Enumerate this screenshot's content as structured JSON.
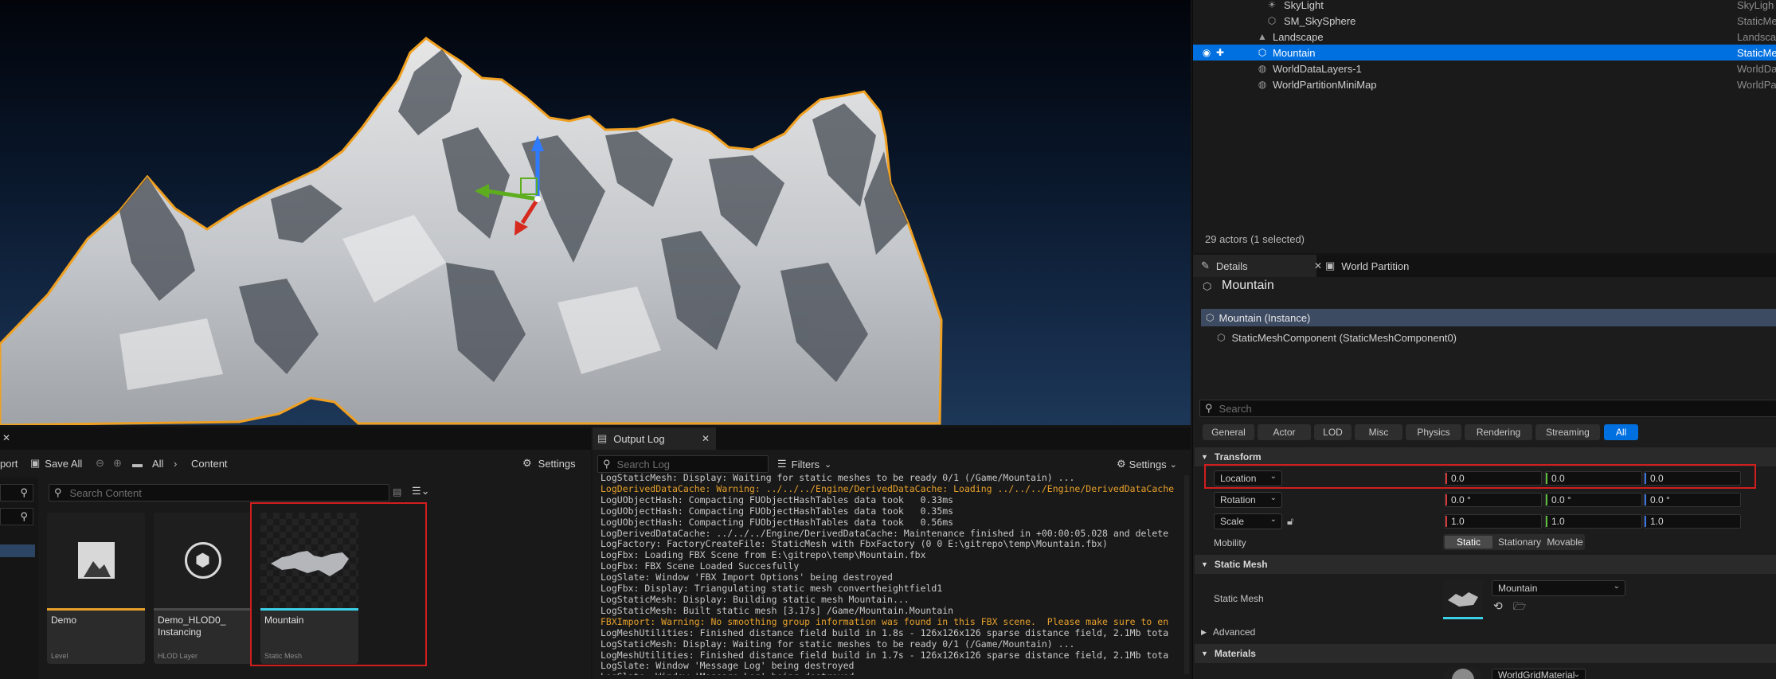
{
  "outliner": {
    "rows": [
      {
        "name": "SkyLight",
        "type": "SkyLigh"
      },
      {
        "name": "SM_SkySphere",
        "type": "StaticMe"
      },
      {
        "name": "Landscape",
        "type": "Landscap"
      },
      {
        "name": "Mountain",
        "type": "StaticMe"
      },
      {
        "name": "WorldDataLayers-1",
        "type": "WorldDat"
      },
      {
        "name": "WorldPartitionMiniMap",
        "type": "WorldPar"
      }
    ],
    "actor_count": "29 actors (1 selected)"
  },
  "details": {
    "tabs": [
      {
        "label": "Details"
      },
      {
        "label": "World Partition"
      }
    ],
    "title": "Mountain",
    "instance": "Mountain (Instance)",
    "component": "StaticMeshComponent (StaticMeshComponent0)",
    "search_placeholder": "Search",
    "filters": [
      "General",
      "Actor",
      "LOD",
      "Misc",
      "Physics",
      "Rendering",
      "Streaming",
      "All"
    ],
    "transform": {
      "section": "Transform",
      "location": {
        "label": "Location",
        "x": "0.0",
        "y": "0.0",
        "z": "0.0"
      },
      "rotation": {
        "label": "Rotation",
        "x": "0.0 °",
        "y": "0.0 °",
        "z": "0.0 °"
      },
      "scale": {
        "label": "Scale",
        "x": "1.0",
        "y": "1.0",
        "z": "1.0"
      },
      "mobility": {
        "label": "Mobility",
        "options": [
          "Static",
          "Stationary",
          "Movable"
        ],
        "selected": "Static"
      }
    },
    "static_mesh": {
      "section": "Static Mesh",
      "label": "Static Mesh",
      "value": "Mountain"
    },
    "advanced": "Advanced",
    "materials": {
      "section": "Materials",
      "value": "WorldGridMaterial"
    }
  },
  "content_browser": {
    "toolbar": {
      "import": "port",
      "save_all": "Save All",
      "path_all": "All",
      "path_content": "Content",
      "settings": "Settings"
    },
    "search_placeholder": "Search Content",
    "assets": [
      {
        "name": "Demo",
        "type": "Level"
      },
      {
        "name": "Demo_HLOD0_ Instancing",
        "type": "HLOD Layer"
      },
      {
        "name": "Mountain",
        "type": "Static Mesh"
      }
    ]
  },
  "output_log": {
    "tab": "Output Log",
    "search_placeholder": "Search Log",
    "filters": "Filters",
    "settings": "Settings",
    "lines": [
      {
        "t": "LogStaticMesh: Display: Waiting for static meshes to be ready 0/1 (/Game/Mountain) ...",
        "w": false
      },
      {
        "t": "LogDerivedDataCache: Warning: ../../../Engine/DerivedDataCache: Loading ../../../Engine/DerivedDataCache",
        "w": true
      },
      {
        "t": "LogUObjectHash: Compacting FUObjectHashTables data took   0.33ms",
        "w": false
      },
      {
        "t": "LogUObjectHash: Compacting FUObjectHashTables data took   0.35ms",
        "w": false
      },
      {
        "t": "LogUObjectHash: Compacting FUObjectHashTables data took   0.56ms",
        "w": false
      },
      {
        "t": "LogDerivedDataCache: ../../../Engine/DerivedDataCache: Maintenance finished in +00:00:05.028 and delete",
        "w": false
      },
      {
        "t": "LogFactory: FactoryCreateFile: StaticMesh with FbxFactory (0 0 E:\\gitrepo\\temp\\Mountain.fbx)",
        "w": false
      },
      {
        "t": "LogFbx: Loading FBX Scene from E:\\gitrepo\\temp\\Mountain.fbx",
        "w": false
      },
      {
        "t": "LogFbx: FBX Scene Loaded Succesfully",
        "w": false
      },
      {
        "t": "LogSlate: Window 'FBX Import Options' being destroyed",
        "w": false
      },
      {
        "t": "LogFbx: Display: Triangulating static mesh convertheightfield1",
        "w": false
      },
      {
        "t": "LogStaticMesh: Display: Building static mesh Mountain...",
        "w": false
      },
      {
        "t": "LogStaticMesh: Built static mesh [3.17s] /Game/Mountain.Mountain",
        "w": false
      },
      {
        "t": "FBXImport: Warning: No smoothing group information was found in this FBX scene.  Please make sure to en",
        "w": true
      },
      {
        "t": "LogMeshUtilities: Finished distance field build in 1.8s - 126x126x126 sparse distance field, 2.1Mb tota",
        "w": false
      },
      {
        "t": "LogStaticMesh: Display: Waiting for static meshes to be ready 0/1 (/Game/Mountain) ...",
        "w": false
      },
      {
        "t": "LogMeshUtilities: Finished distance field build in 1.7s - 126x126x126 sparse distance field, 2.1Mb tota",
        "w": false
      },
      {
        "t": "LogSlate: Window 'Message Log' being destroyed",
        "w": false
      },
      {
        "t": "LogSlate: Window 'Message Log' being destroyed",
        "w": false
      }
    ]
  },
  "colors": {
    "selection": "#0070e0",
    "highlight_box": "#d11e1e",
    "warning": "#e6a02a",
    "outline": "#f0a020"
  }
}
